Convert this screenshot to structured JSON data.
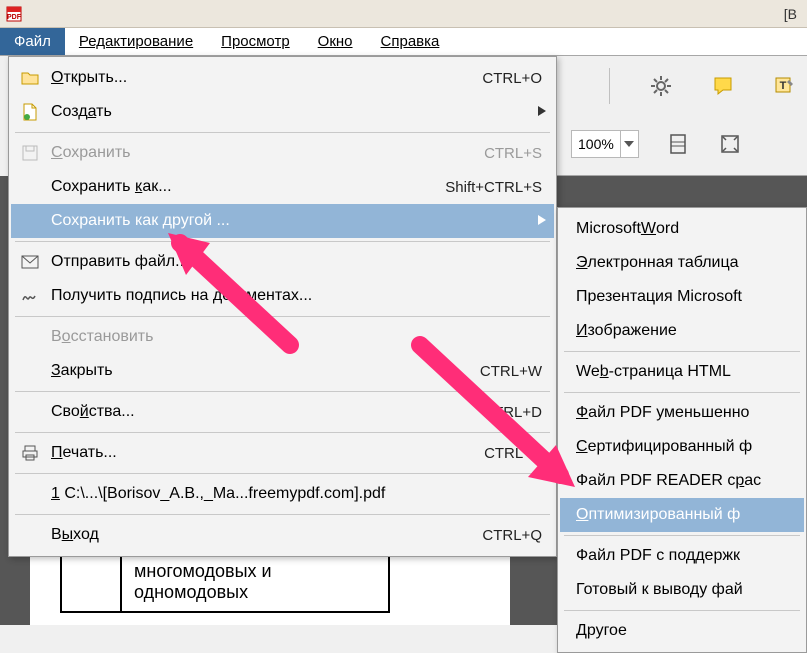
{
  "titlebar": {
    "title_right": "[В"
  },
  "menubar": {
    "file": "Файл",
    "edit": "Редактирование",
    "view": "Просмотр",
    "window": "Окно",
    "help": "Справка"
  },
  "toolbar": {
    "zoom": "100%"
  },
  "file_menu": {
    "open": "Открыть...",
    "open_sc": "CTRL+O",
    "create": "Создать",
    "save": "Сохранить",
    "save_sc": "CTRL+S",
    "save_as": "Сохранить как...",
    "save_as_sc": "Shift+CTRL+S",
    "save_other": "Сохранить как другой ...",
    "send": "Отправить файл...",
    "signature": "Получить подпись на документах...",
    "restore": "Восстановить",
    "close": "Закрыть",
    "close_sc": "CTRL+W",
    "properties": "Свойства...",
    "properties_sc": "CTRL+D",
    "print": "Печать...",
    "print_sc": "CTRL+P",
    "recent": "1 C:\\...\\[Borisov_A.B.,_Ma...freemypdf.com].pdf",
    "exit": "Выход",
    "exit_sc": "CTRL+Q"
  },
  "save_other_submenu": {
    "word": "Microsoft Word",
    "spreadsheet": "Электронная таблица",
    "powerpoint": "Презентация Microsoft",
    "image": "Изображение",
    "html": "Web-страница HTML",
    "reduced": "Файл PDF уменьшенно",
    "certified": "Сертифицированный ф",
    "reader": "Файл PDF READER с рас",
    "optimized": "Оптимизированный ф",
    "archive": "Файл PDF с поддержк",
    "press": "Готовый к выводу фай",
    "other": "Другое"
  },
  "document": {
    "cell_text": "многомодовых и одномодовых"
  }
}
